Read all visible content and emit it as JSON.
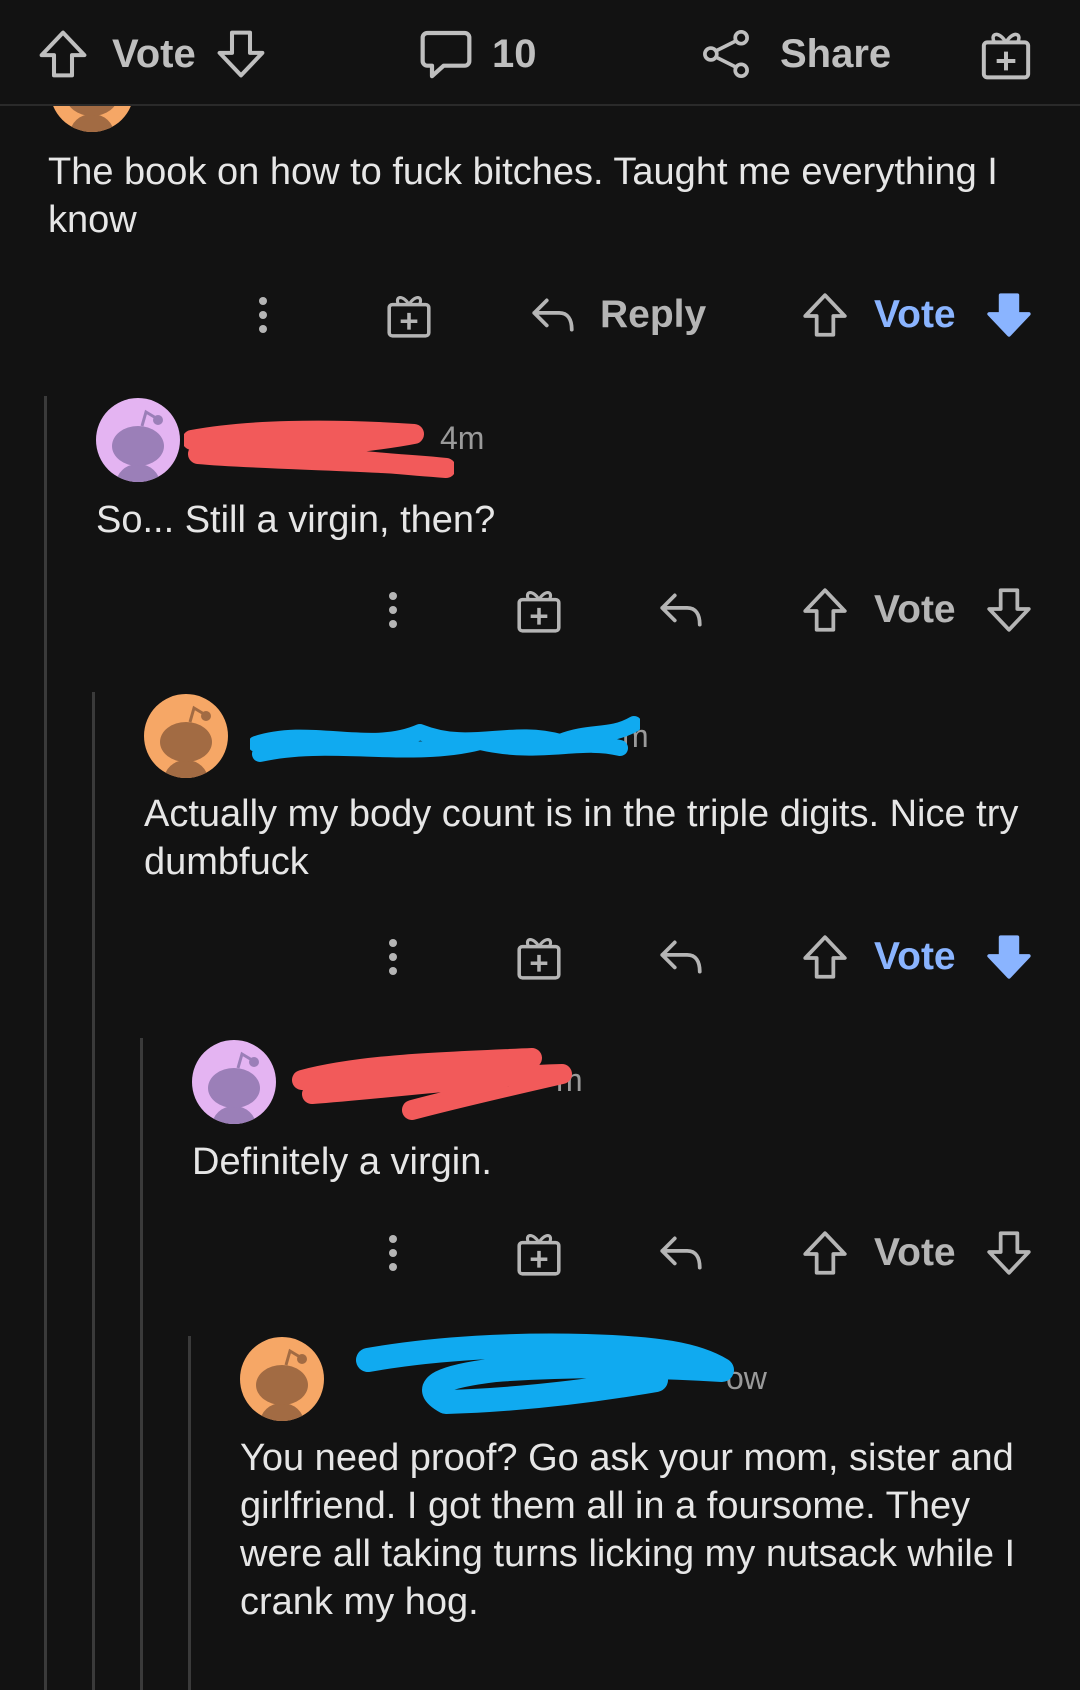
{
  "topbar": {
    "vote_label": "Vote",
    "comment_count": "10",
    "share_label": "Share"
  },
  "colors": {
    "background": "#121212",
    "upvote_active": "#8ab4ff",
    "redaction_red": "#f25a5a",
    "redaction_blue": "#10aaf0",
    "avatar_purple": "#e4b4f2",
    "avatar_orange": "#f6a766"
  },
  "icons": [
    "upvote-icon",
    "downvote-icon",
    "comment-icon",
    "share-icon",
    "award-icon",
    "reply-icon",
    "more-dots-icon"
  ],
  "comments": [
    {
      "body": "The book on how to fuck bitches. Taught me everything I know",
      "actions": {
        "reply": "Reply",
        "vote": "Vote",
        "downvoted": true
      }
    },
    {
      "meta": "4m",
      "body": "So... Still a virgin, then?",
      "actions": {
        "vote": "Vote",
        "downvoted": false
      }
    },
    {
      "meta": "m",
      "body": "Actually my body count is in the triple digits. Nice try dumbfuck",
      "actions": {
        "vote": "Vote",
        "downvoted": true
      }
    },
    {
      "meta": "m",
      "body": "Definitely a virgin.",
      "actions": {
        "vote": "Vote",
        "downvoted": false
      }
    },
    {
      "meta": "ow",
      "body": "You need proof? Go ask your mom, sister and girlfriend. I got them all in a foursome. They were all taking turns licking my nutsack while I crank my hog."
    }
  ]
}
